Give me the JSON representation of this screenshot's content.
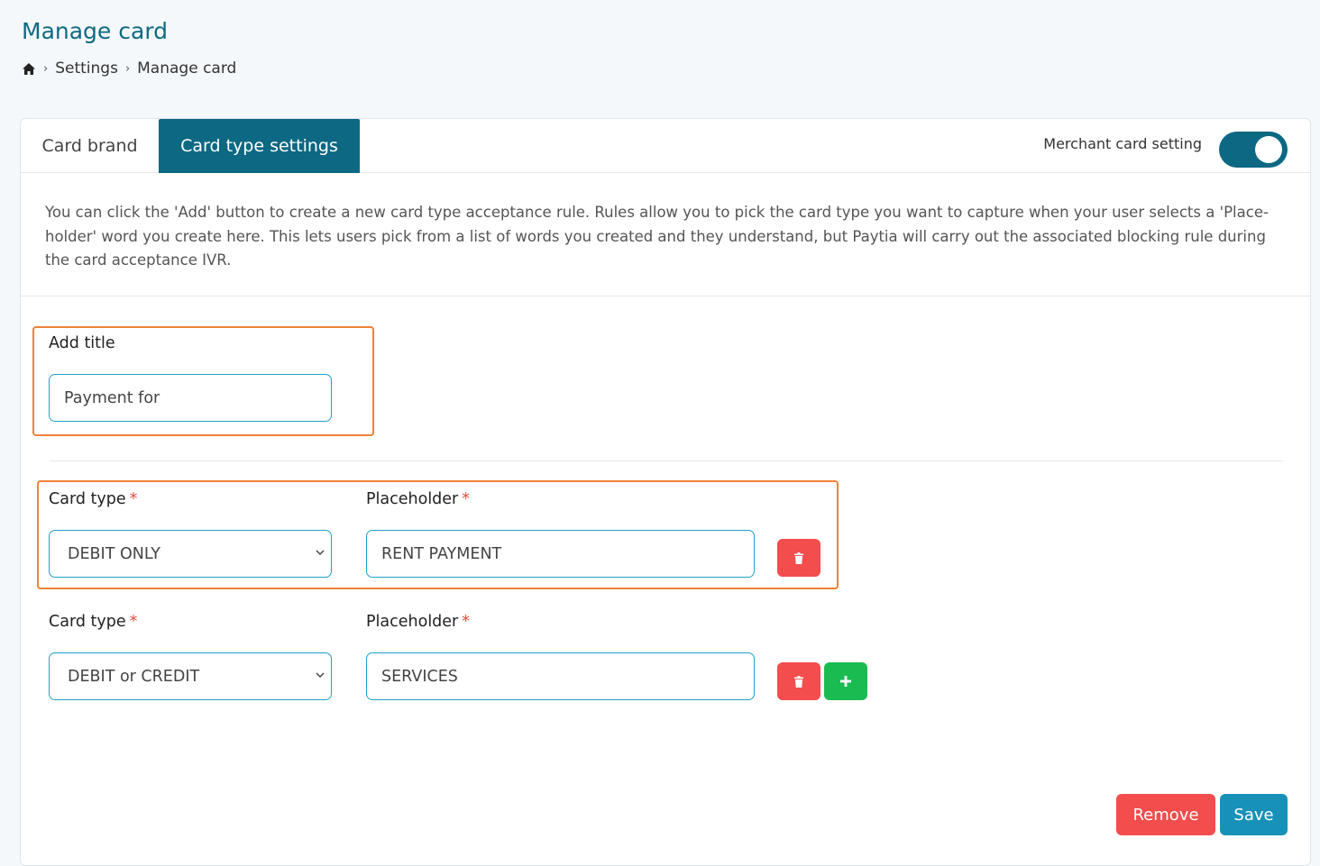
{
  "header": {
    "title": "Manage card",
    "breadcrumb": [
      "Settings",
      "Manage card"
    ]
  },
  "tabs": [
    {
      "label": "Card brand",
      "active": false
    },
    {
      "label": "Card type settings",
      "active": true
    }
  ],
  "merchant_setting": {
    "label": "Merchant card setting",
    "enabled": true
  },
  "intro_text": "You can click the 'Add' button to create a new card type acceptance rule. Rules allow you to pick the card type you want to capture when your user selects a 'Place-holder' word you create here. This lets users pick from a list of words you created and they understand, but Paytia will carry out the associated blocking rule during the card acceptance IVR.",
  "title_field": {
    "label": "Add title",
    "value": "Payment for"
  },
  "rules": [
    {
      "card_type_label": "Card type",
      "card_type_value": "DEBIT ONLY",
      "placeholder_label": "Placeholder",
      "placeholder_value": "RENT PAYMENT",
      "required_mark": "*"
    },
    {
      "card_type_label": "Card type",
      "card_type_value": "DEBIT or CREDIT",
      "placeholder_label": "Placeholder",
      "placeholder_value": "SERVICES",
      "required_mark": "*"
    }
  ],
  "actions": {
    "remove_label": "Remove",
    "save_label": "Save"
  },
  "colors": {
    "primary": "#0c6883",
    "danger": "#f44d4d",
    "success": "#1abc52",
    "highlight": "#ef8239"
  }
}
